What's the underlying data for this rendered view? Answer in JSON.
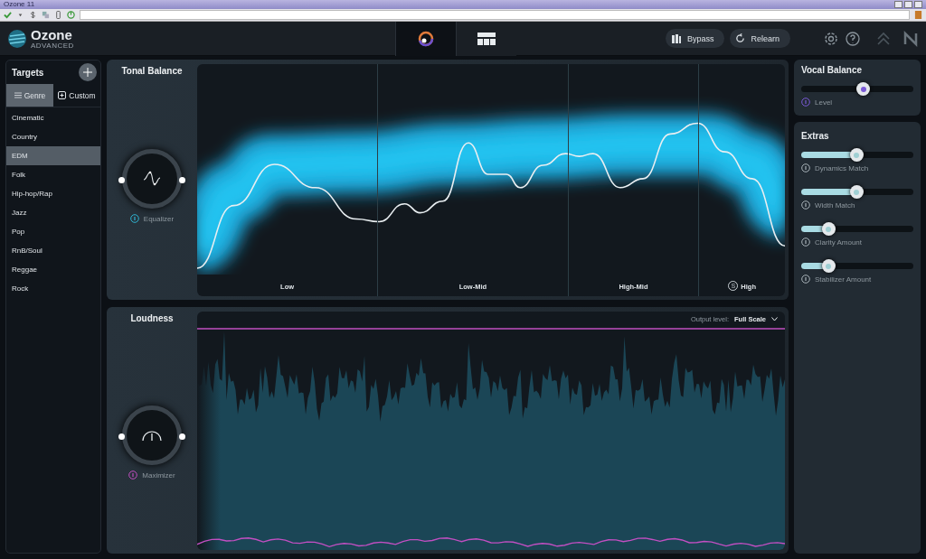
{
  "window": {
    "title": "Ozone 11"
  },
  "app": {
    "logo": "Ozone",
    "edition": "ADVANCED"
  },
  "modules": [
    {
      "kind": "assistant",
      "selected": true
    },
    {
      "kind": "grid",
      "selected": false
    }
  ],
  "header_buttons": {
    "bypass": "Bypass",
    "relearn": "Relearn"
  },
  "targets": {
    "title": "Targets",
    "tabs": [
      {
        "label": "Genre",
        "kind": "list",
        "selected": true
      },
      {
        "label": "Custom",
        "kind": "add",
        "selected": false
      }
    ],
    "items": [
      {
        "label": "Cinematic",
        "selected": false
      },
      {
        "label": "Country",
        "selected": false
      },
      {
        "label": "EDM",
        "selected": true
      },
      {
        "label": "Folk",
        "selected": false
      },
      {
        "label": "Hip-hop/Rap",
        "selected": false
      },
      {
        "label": "Jazz",
        "selected": false
      },
      {
        "label": "Pop",
        "selected": false
      },
      {
        "label": "RnB/Soul",
        "selected": false
      },
      {
        "label": "Reggae",
        "selected": false
      },
      {
        "label": "Rock",
        "selected": false
      }
    ]
  },
  "tonal_balance": {
    "title": "Tonal Balance",
    "module": "Equalizer",
    "bands": [
      {
        "label": "Low"
      },
      {
        "label": "Low-Mid"
      },
      {
        "label": "High-Mid"
      },
      {
        "label": "High",
        "solo": "S"
      }
    ]
  },
  "loudness": {
    "title": "Loudness",
    "module": "Maximizer",
    "output_label": "Output level:",
    "output_value": "Full Scale"
  },
  "vocal_balance": {
    "title": "Vocal Balance",
    "sliders": [
      {
        "label": "Level",
        "kind": "center",
        "level": 0.55
      }
    ]
  },
  "extras": {
    "title": "Extras",
    "sliders": [
      {
        "label": "Dynamics Match",
        "kind": "fill",
        "level": 0.49
      },
      {
        "label": "Width Match",
        "kind": "fill",
        "level": 0.49
      },
      {
        "label": "Clarity Amount",
        "kind": "fill",
        "level": 0.24
      },
      {
        "label": "Stabilizer Amount",
        "kind": "fill",
        "level": 0.24
      }
    ]
  }
}
